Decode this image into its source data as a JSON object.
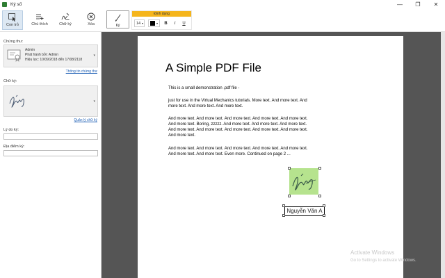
{
  "window": {
    "title": "Ký số"
  },
  "toolbar": {
    "pointer_label": "Con trỏ",
    "comment_label": "Chú thích",
    "signature_label": "Chữ ký",
    "delete_label": "Xóa",
    "sign_label": "Ký",
    "format": {
      "header": "Định dạng",
      "font_size": "14",
      "bold": "B",
      "italic": "I",
      "underline": "U",
      "color": "#000000"
    }
  },
  "sidebar": {
    "certificate_label": "Chứng thư:",
    "certificate": {
      "name": "Admin",
      "issuer": "Phát hành bởi: Admin",
      "validity": "Hiệu lực: 10/09/2018 đến 17/08/2118"
    },
    "certificate_info_link": "Thông tin chứng thư",
    "signature_label": "Chữ ký:",
    "signature_manage_link": "Quản lý chữ ký",
    "reason_label": "Lý do ký:",
    "reason_value": "",
    "location_label": "Địa điểm ký:",
    "location_value": ""
  },
  "document": {
    "title": "A Simple PDF File",
    "paragraphs": [
      "This is a small demonstration .pdf file -",
      "just for use in the Virtual Mechanics tutorials. More text. And more text. And more text. And more text. And more text.",
      "And more text. And more text. And more text. And more text. And more text. And more text. Boring, zzzzz. And more text. And more text. And more text. And more text. And more text. And more text. And more text. And more text. And more text.",
      "And more text. And more text. And more text. And more text. And more text. And more text. And more text. Even more. Continued on page 2 ..."
    ],
    "signer_name": "Nguyễn Văn A"
  },
  "watermark": {
    "line1": "Activate Windows",
    "line2": "Go to Settings to activate Windows."
  }
}
